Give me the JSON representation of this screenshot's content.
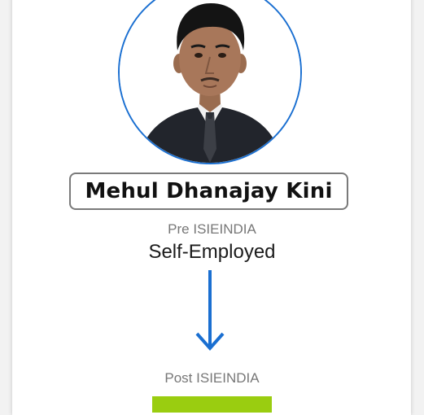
{
  "profile": {
    "name": "Mehul Dhanajay Kini",
    "photo_icon": "person-portrait-photo"
  },
  "pre": {
    "label": "Pre ISIEINDIA",
    "value": "Self-Employed"
  },
  "transition": {
    "icon": "arrow-down-icon"
  },
  "post": {
    "label": "Post ISIEINDIA",
    "value": ""
  },
  "colors": {
    "accent": "#1a6fd1",
    "badge": "#9acd10",
    "border": "#7a7a7a"
  }
}
